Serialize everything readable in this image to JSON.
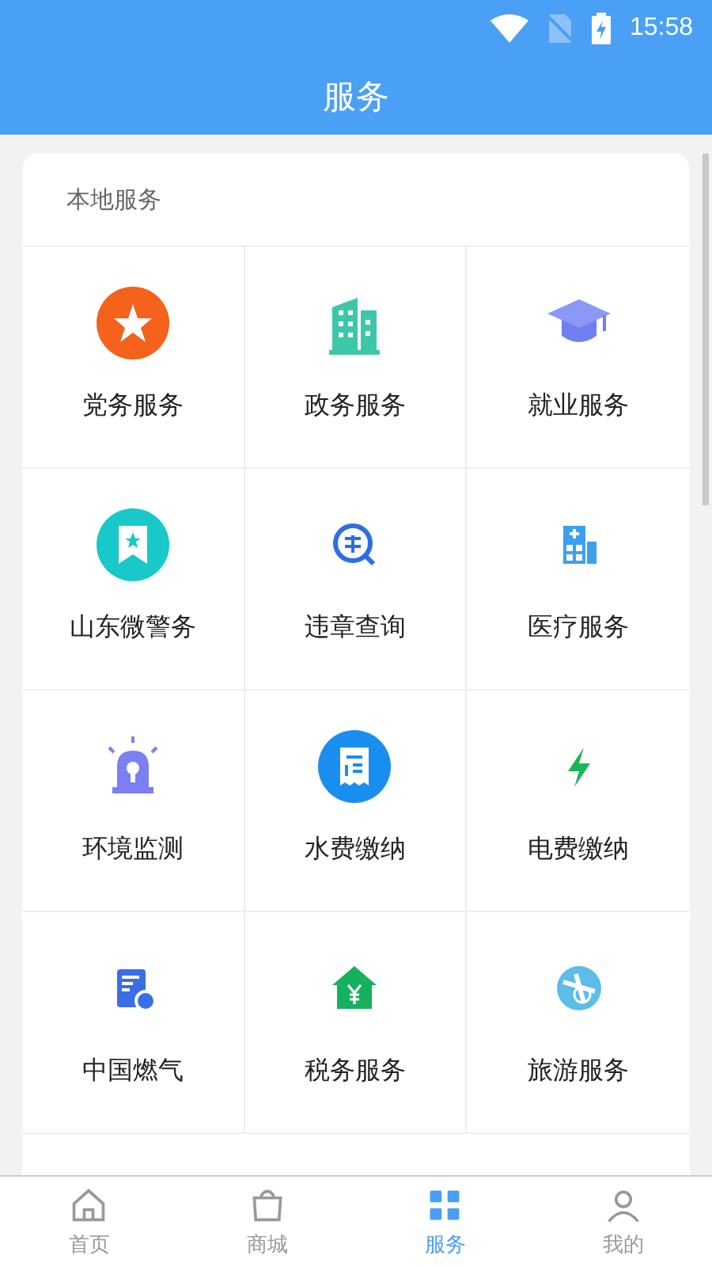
{
  "status_bar": {
    "time": "15:58"
  },
  "header": {
    "title": "服务"
  },
  "section": {
    "title": "本地服务",
    "services": [
      {
        "label": "党务服务"
      },
      {
        "label": "政务服务"
      },
      {
        "label": "就业服务"
      },
      {
        "label": "山东微警务"
      },
      {
        "label": "违章查询"
      },
      {
        "label": "医疗服务"
      },
      {
        "label": "环境监测"
      },
      {
        "label": "水费缴纳"
      },
      {
        "label": "电费缴纳"
      },
      {
        "label": "中国燃气"
      },
      {
        "label": "税务服务"
      },
      {
        "label": "旅游服务"
      }
    ]
  },
  "tabs": [
    {
      "label": "首页",
      "selected": false
    },
    {
      "label": "商城",
      "selected": false
    },
    {
      "label": "服务",
      "selected": true
    },
    {
      "label": "我的",
      "selected": false
    }
  ]
}
